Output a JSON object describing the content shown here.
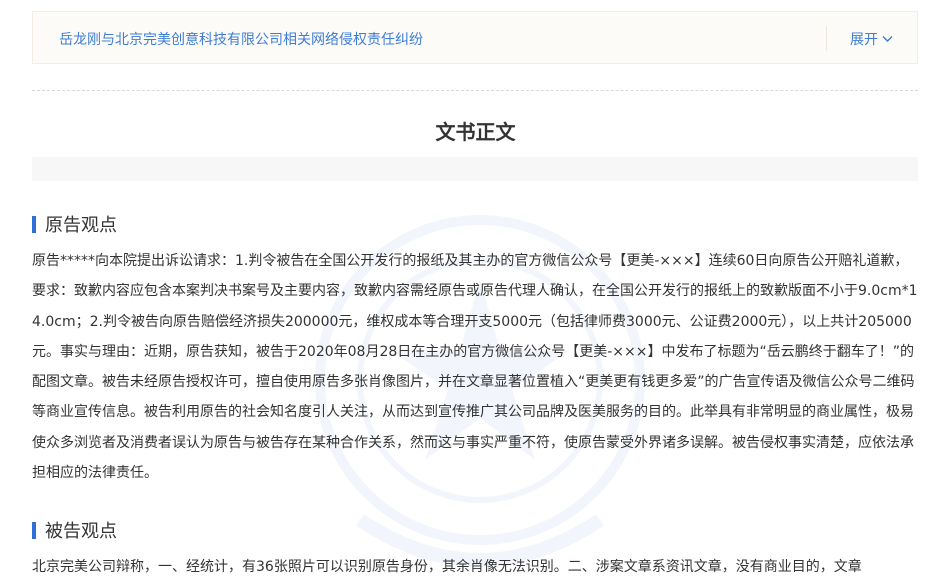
{
  "case_bar": {
    "title": "岳龙刚与北京完美创意科技有限公司相关网络侵权责任纠纷",
    "expand_label": "展开"
  },
  "document": {
    "title": "文书正文"
  },
  "sections": {
    "plaintiff": {
      "heading": "原告观点",
      "body": "原告*****向本院提出诉讼请求：1.判令被告在全国公开发行的报纸及其主办的官方微信公众号【更美-×××】连续60日向原告公开赔礼道歉，要求：致歉内容应包含本案判决书案号及主要内容，致歉内容需经原告或原告代理人确认，在全国公开发行的报纸上的致歉版面不小于9.0cm*14.0cm；2.判令被告向原告赔偿经济损失200000元，维权成本等合理开支5000元（包括律师费3000元、公证费2000元），以上共计205000元。事实与理由：近期，原告获知，被告于2020年08月28日在主办的官方微信公众号【更美-×××】中发布了标题为“岳云鹏终于翻车了！”的配图文章。被告未经原告授权许可，擅自使用原告多张肖像图片，并在文章显著位置植入“更美更有钱更多爱”的广告宣传语及微信公众号二维码等商业宣传信息。被告利用原告的社会知名度引人关注，从而达到宣传推广其公司品牌及医美服务的目的。此举具有非常明显的商业属性，极易使众多浏览者及消费者误认为原告与被告存在某种合作关系，然而这与事实严重不符，使原告蒙受外界诸多误解。被告侵权事实清楚，应依法承担相应的法律责任。"
    },
    "defendant": {
      "heading": "被告观点",
      "body": "北京完美公司辩称，一、经统计，有36张照片可以识别原告身份，其余肖像无法识别。二、涉案文章系资讯文章，没有商业目的，文章"
    }
  },
  "colors": {
    "link": "#3d7dd4",
    "accent_bar": "#2f6fd6",
    "text": "#333333"
  },
  "icons": {
    "expand": "chevron-down-icon",
    "watermark": "emblem-watermark"
  }
}
